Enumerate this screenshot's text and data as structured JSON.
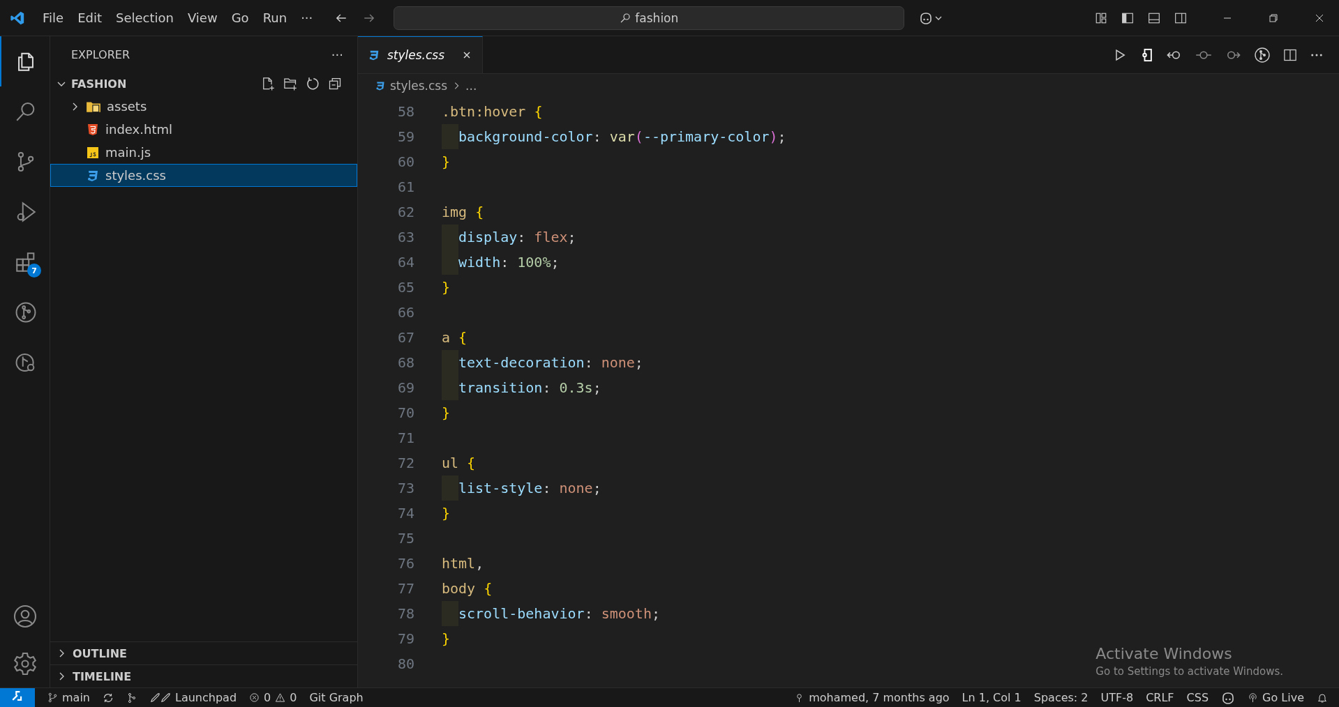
{
  "title_bar": {
    "menu": [
      "File",
      "Edit",
      "Selection",
      "View",
      "Go",
      "Run",
      "···"
    ],
    "search": {
      "value": "fashion"
    }
  },
  "activity_bar": {
    "items": [
      {
        "kind": "explorer",
        "selected": true
      },
      {
        "kind": "search",
        "selected": false
      },
      {
        "kind": "source-control",
        "selected": false
      },
      {
        "kind": "run",
        "selected": false
      },
      {
        "kind": "extensions",
        "selected": false,
        "badge": "7"
      },
      {
        "kind": "git-graph",
        "selected": false
      },
      {
        "kind": "git-history",
        "selected": false
      }
    ]
  },
  "sidebar": {
    "title": "EXPLORER",
    "more": "···",
    "folder": {
      "name": "FASHION",
      "expanded": true,
      "items": [
        {
          "kind": "folder",
          "name": "assets",
          "expanded": false,
          "selected": false
        },
        {
          "kind": "html",
          "name": "index.html",
          "selected": false
        },
        {
          "kind": "js",
          "name": "main.js",
          "selected": false
        },
        {
          "kind": "css",
          "name": "styles.css",
          "selected": true
        }
      ]
    },
    "sections": [
      {
        "name": "OUTLINE",
        "expanded": false
      },
      {
        "name": "TIMELINE",
        "expanded": false
      }
    ]
  },
  "editor": {
    "tabs": [
      {
        "name": "styles.css",
        "selected": true
      }
    ],
    "breadcrumbs": [
      "styles.css",
      "..."
    ],
    "lines": [
      {
        "num": "58",
        "indent": false,
        "tokens": [
          {
            "kind": "selector",
            "text": ".btn:hover"
          },
          {
            "kind": "brace",
            "text": "{"
          }
        ]
      },
      {
        "num": "59",
        "indent": true,
        "tokens": [
          {
            "kind": "property",
            "text": "background-color"
          },
          {
            "kind": "colon",
            "text": ":"
          },
          {
            "kind": "function",
            "text": "var"
          },
          {
            "kind": "paren",
            "text": "("
          },
          {
            "kind": "variable",
            "text": "--primary-color"
          },
          {
            "kind": "paren",
            "text": ")"
          },
          {
            "kind": "plain",
            "text": ";"
          }
        ]
      },
      {
        "num": "60",
        "indent": false,
        "tokens": [
          {
            "kind": "brace",
            "text": "}"
          }
        ]
      },
      {
        "num": "61",
        "indent": false
      },
      {
        "num": "62",
        "indent": false,
        "tokens": [
          {
            "kind": "selector",
            "text": "img"
          },
          {
            "kind": "brace",
            "text": "{"
          }
        ]
      },
      {
        "num": "63",
        "indent": true,
        "tokens": [
          {
            "kind": "property",
            "text": "display"
          },
          {
            "kind": "colon",
            "text": ":"
          },
          {
            "kind": "value",
            "text": "flex"
          },
          {
            "kind": "plain",
            "text": ";"
          }
        ]
      },
      {
        "num": "64",
        "indent": true,
        "tokens": [
          {
            "kind": "property",
            "text": "width"
          },
          {
            "kind": "colon",
            "text": ":"
          },
          {
            "kind": "number",
            "text": "100%"
          },
          {
            "kind": "plain",
            "text": ";"
          }
        ]
      },
      {
        "num": "65",
        "indent": false,
        "tokens": [
          {
            "kind": "brace",
            "text": "}"
          }
        ]
      },
      {
        "num": "66",
        "indent": false
      },
      {
        "num": "67",
        "indent": false,
        "tokens": [
          {
            "kind": "selector",
            "text": "a"
          },
          {
            "kind": "brace",
            "text": "{"
          }
        ]
      },
      {
        "num": "68",
        "indent": true,
        "tokens": [
          {
            "kind": "property",
            "text": "text-decoration"
          },
          {
            "kind": "colon",
            "text": ":"
          },
          {
            "kind": "value",
            "text": "none"
          },
          {
            "kind": "plain",
            "text": ";"
          }
        ]
      },
      {
        "num": "69",
        "indent": true,
        "tokens": [
          {
            "kind": "property",
            "text": "transition"
          },
          {
            "kind": "colon",
            "text": ":"
          },
          {
            "kind": "number",
            "text": "0.3s"
          },
          {
            "kind": "plain",
            "text": ";"
          }
        ]
      },
      {
        "num": "70",
        "indent": false,
        "tokens": [
          {
            "kind": "brace",
            "text": "}"
          }
        ]
      },
      {
        "num": "71",
        "indent": false
      },
      {
        "num": "72",
        "indent": false,
        "tokens": [
          {
            "kind": "selector",
            "text": "ul"
          },
          {
            "kind": "brace",
            "text": "{"
          }
        ]
      },
      {
        "num": "73",
        "indent": true,
        "tokens": [
          {
            "kind": "property",
            "text": "list-style"
          },
          {
            "kind": "colon",
            "text": ":"
          },
          {
            "kind": "value",
            "text": "none"
          },
          {
            "kind": "plain",
            "text": ";"
          }
        ]
      },
      {
        "num": "74",
        "indent": false,
        "tokens": [
          {
            "kind": "brace",
            "text": "}"
          }
        ]
      },
      {
        "num": "75",
        "indent": false
      },
      {
        "num": "76",
        "indent": false,
        "tokens": [
          {
            "kind": "selector",
            "text": "html"
          },
          {
            "kind": "plain",
            "text": ","
          }
        ]
      },
      {
        "num": "77",
        "indent": false,
        "tokens": [
          {
            "kind": "selector",
            "text": "body"
          },
          {
            "kind": "brace",
            "text": "{"
          }
        ]
      },
      {
        "num": "78",
        "indent": true,
        "tokens": [
          {
            "kind": "property",
            "text": "scroll-behavior"
          },
          {
            "kind": "colon",
            "text": ":"
          },
          {
            "kind": "value",
            "text": "smooth"
          },
          {
            "kind": "plain",
            "text": ";"
          }
        ]
      },
      {
        "num": "79",
        "indent": false,
        "tokens": [
          {
            "kind": "brace",
            "text": "}"
          }
        ]
      },
      {
        "num": "80",
        "indent": false
      }
    ]
  },
  "activation_notice": {
    "title": "Activate Windows",
    "message": "Go to Settings to activate Windows."
  },
  "status_bar": {
    "left": [
      {
        "kind": "branch",
        "text": "main"
      },
      {
        "kind": "sync"
      },
      {
        "kind": "git"
      },
      {
        "kind": "launchpad",
        "text": "Launchpad"
      },
      {
        "kind": "problems",
        "errors": "0",
        "warnings": "0"
      },
      {
        "kind": "plain",
        "text": "Git Graph"
      }
    ],
    "right": [
      {
        "kind": "blame",
        "text": "mohamed, 7 months ago"
      },
      {
        "kind": "plain",
        "text": "Ln 1, Col 1"
      },
      {
        "kind": "plain",
        "text": "Spaces: 2"
      },
      {
        "kind": "plain",
        "text": "UTF-8"
      },
      {
        "kind": "plain",
        "text": "CRLF"
      },
      {
        "kind": "plain",
        "text": "CSS"
      },
      {
        "kind": "copilot"
      },
      {
        "kind": "golive",
        "text": "Go Live"
      },
      {
        "kind": "bell"
      }
    ]
  }
}
